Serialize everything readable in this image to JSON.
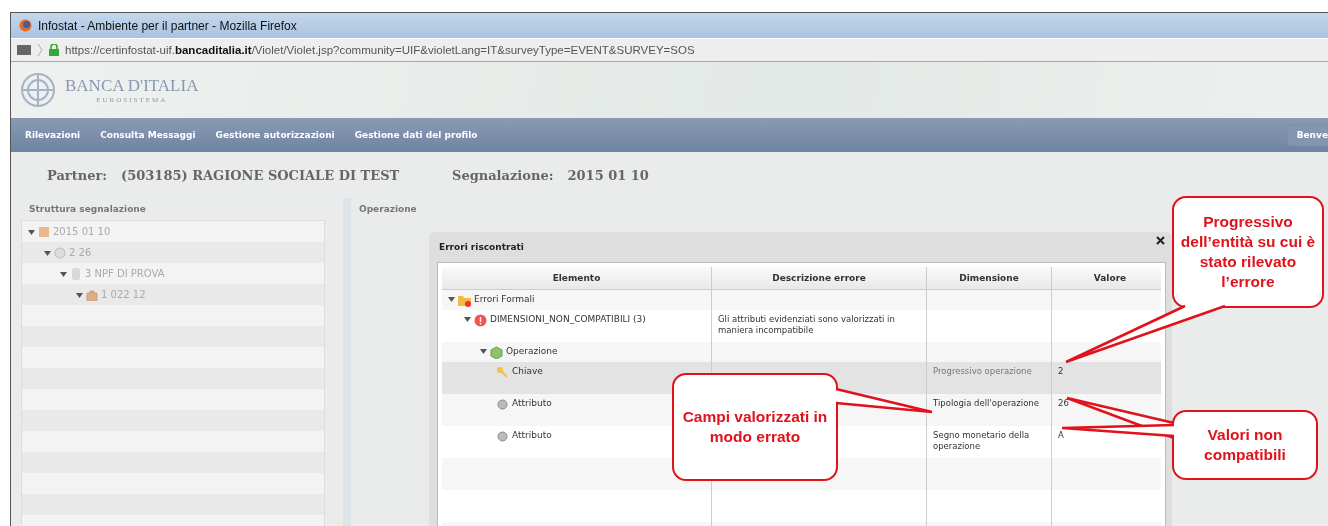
{
  "window": {
    "title": "Infostat - Ambiente per il partner - Mozilla Firefox"
  },
  "address_bar": {
    "url": "https://certinfostat-uif.**bancaditalia.it**/Violet/Violet.jsp?community=UIF&violetLang=IT&surveyType=EVENT&SURVEY=SOS"
  },
  "banner": {
    "title": "BANCA D'ITALIA",
    "subtitle": "EUROSISTEMA"
  },
  "nav": {
    "items": [
      "Rilevazioni",
      "Consulta Messaggi",
      "Gestione autorizzazioni",
      "Gestione dati del profilo"
    ],
    "user_button": "Benve"
  },
  "context": [
    {
      "label": "Partner:",
      "value": "(503185) RAGIONE SOCIALE DI TEST"
    },
    {
      "label": "Segnalazione:",
      "value": "2015 01 10"
    }
  ],
  "left_panel": {
    "title": "Struttura segnalazione",
    "tree": [
      {
        "label": "2015 01 10",
        "kind": "calendar",
        "expanded": true,
        "children": [
          {
            "label": "2 26",
            "kind": "circle",
            "expanded": true,
            "children": [
              {
                "label": "3 NPF DI PROVA",
                "kind": "document",
                "expanded": true,
                "children": [
                  {
                    "label": "1 022 12",
                    "kind": "bag",
                    "expanded": true
                  }
                ]
              }
            ]
          }
        ]
      }
    ]
  },
  "right_panel": {
    "title": "Operazione"
  },
  "dialog": {
    "title": "Errori riscontrati",
    "columns": [
      "Elemento",
      "Descrizione errore",
      "Dimensione",
      "Valore"
    ],
    "rows": [
      {
        "element": "Errori Formali",
        "kind": "group",
        "expanded": true,
        "selected": false,
        "children": [
          {
            "element": "DIMENSIONI_NON_COMPATIBILI (3)",
            "kind": "error",
            "expanded": true,
            "selected": false,
            "description": "Gli attributi evidenziati sono valorizzati in maniera incompatibile",
            "children": [
              {
                "element": "Operazione",
                "kind": "entity",
                "expanded": true,
                "selected": false,
                "children": [
                  {
                    "element": "Chiave",
                    "kind": "key",
                    "selected": true,
                    "dimension": "Progressivo operazione",
                    "value": "2"
                  },
                  {
                    "element": "Attributo",
                    "kind": "attribute",
                    "selected": false,
                    "dimension": "Tipologia dell'operazione",
                    "value": "26"
                  },
                  {
                    "element": "Attributo",
                    "kind": "attribute",
                    "selected": false,
                    "dimension": "Segno monetario della operazione",
                    "value": "A"
                  }
                ]
              }
            ]
          }
        ]
      }
    ]
  },
  "callouts": [
    {
      "kind": "progressive",
      "text": "Progressivo dell’entità su cui è stato rilevato l’errore"
    },
    {
      "kind": "fields",
      "text": "Campi valorizzati in modo errato"
    },
    {
      "kind": "values",
      "text": "Valori non compatibili"
    }
  ]
}
